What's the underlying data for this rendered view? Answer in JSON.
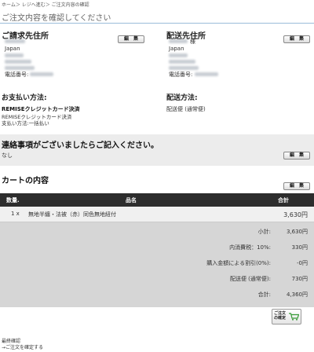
{
  "breadcrumb": "ホーム＞ レジへ進む＞ ご注文内容の確認",
  "page_title": "ご注文内容を確認してください",
  "billing": {
    "heading": "ご請求先住所",
    "edit_label": "編　集",
    "country": "Japan",
    "phone_label": "電話番号:"
  },
  "shipping": {
    "heading": "配送先住所",
    "edit_label": "編　集",
    "honorific": "様",
    "country": "Japan",
    "phone_label": "電話番号:"
  },
  "payment": {
    "heading": "お支払い方法:",
    "method_bold": "REMISEクレジットカード決済",
    "method": "REMISEクレジットカード決済",
    "option": "支払い方法:一括払い"
  },
  "delivery": {
    "heading": "配送方法:",
    "method": "配送便 (通常便)"
  },
  "notice": {
    "heading": "連絡事項がございましたらご記入ください。",
    "value": "なし",
    "edit_label": "編　集"
  },
  "cart": {
    "heading": "カートの内容",
    "edit_label": "編　集",
    "columns": {
      "qty": "数量.",
      "name": "品名",
      "total": "合計"
    },
    "items": [
      {
        "qty": "1 x",
        "name": "無地半纏・法被（赤）同色無地紐付",
        "total": "3,630円"
      }
    ],
    "summary": [
      {
        "label": "小計:",
        "value": "3,630円"
      },
      {
        "label": "内消費税：10%:",
        "value": "330円"
      },
      {
        "label": "購入金額による割引(0%):",
        "value": "-0円"
      },
      {
        "label": "配送便 (通常便):",
        "value": "730円"
      },
      {
        "label": "合計:",
        "value": "4,360円"
      }
    ]
  },
  "confirm_button": {
    "line1": "ご注文",
    "line2": "の確定"
  },
  "footer": {
    "line1": "最終確認",
    "line2": "→ご注文を確定する"
  },
  "colors": {
    "header_bar": "#2d2d2d",
    "summary_bg": "#d6d6d6",
    "notice_bg": "#ececec",
    "cart_icon": "#3a9b3a"
  }
}
